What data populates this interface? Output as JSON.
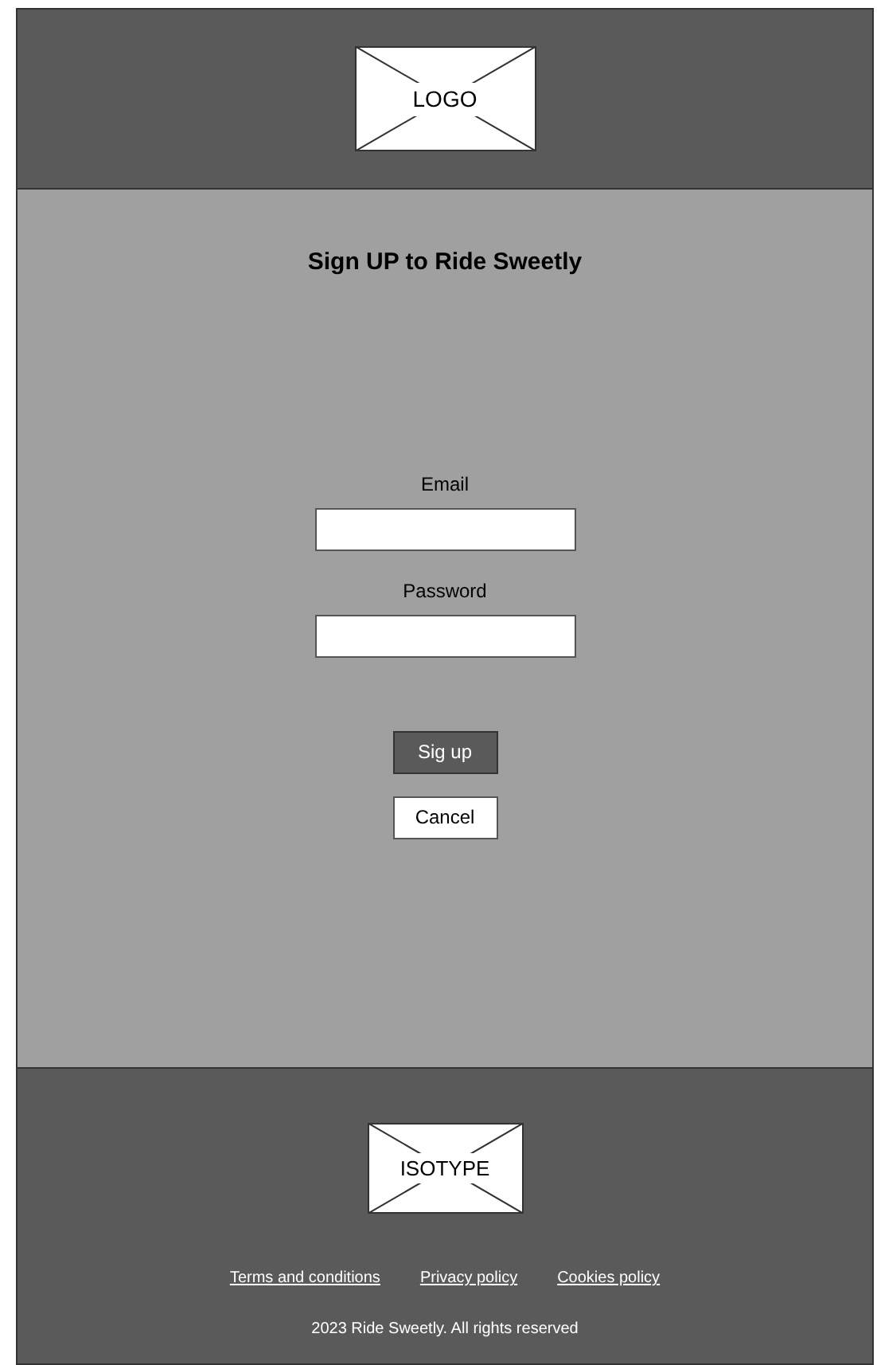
{
  "header": {
    "logo": "LOGO"
  },
  "title": "Sign UP to Ride Sweetly",
  "fields": [
    {
      "label": "Email"
    },
    {
      "label": "Password"
    }
  ],
  "buttons": [
    {
      "label": "Sig up",
      "kind": "primary"
    },
    {
      "label": "Cancel",
      "kind": "secondary"
    }
  ],
  "footer": {
    "isotype": "ISOTYPE",
    "links": [
      "Terms and conditions",
      "Privacy policy",
      "Cookies policy"
    ],
    "copyright": "2023 Ride Sweetly. All rights reserved"
  }
}
